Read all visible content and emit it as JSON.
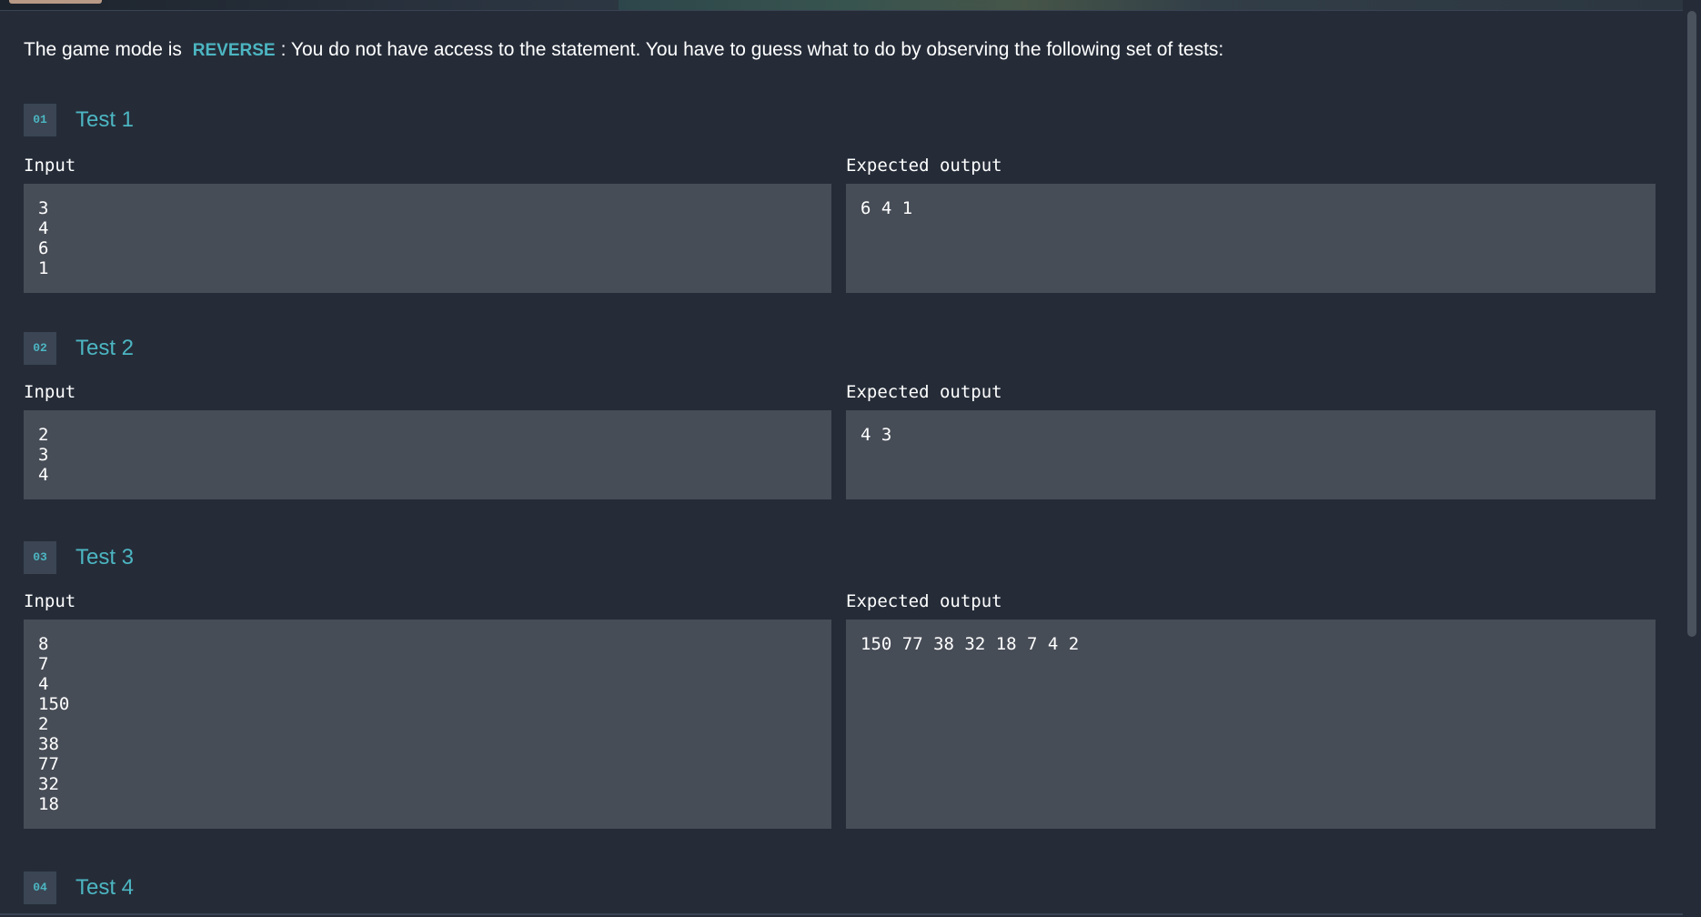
{
  "intro": {
    "prefix": "The game mode is",
    "mode": "REVERSE",
    "suffix": ": You do not have access to the statement. You have to guess what to do by observing the following set of tests:"
  },
  "labels": {
    "input": "Input",
    "expected_output": "Expected output"
  },
  "tests": [
    {
      "number": "01",
      "title": "Test 1",
      "input": "3\n4\n6\n1",
      "output": "6 4 1"
    },
    {
      "number": "02",
      "title": "Test 2",
      "input": "2\n3\n4",
      "output": "4 3"
    },
    {
      "number": "03",
      "title": "Test 3",
      "input": "8\n7\n4\n150\n2\n38\n77\n32\n18",
      "output": "150 77 38 32 18 7 4 2"
    },
    {
      "number": "04",
      "title": "Test 4"
    }
  ]
}
